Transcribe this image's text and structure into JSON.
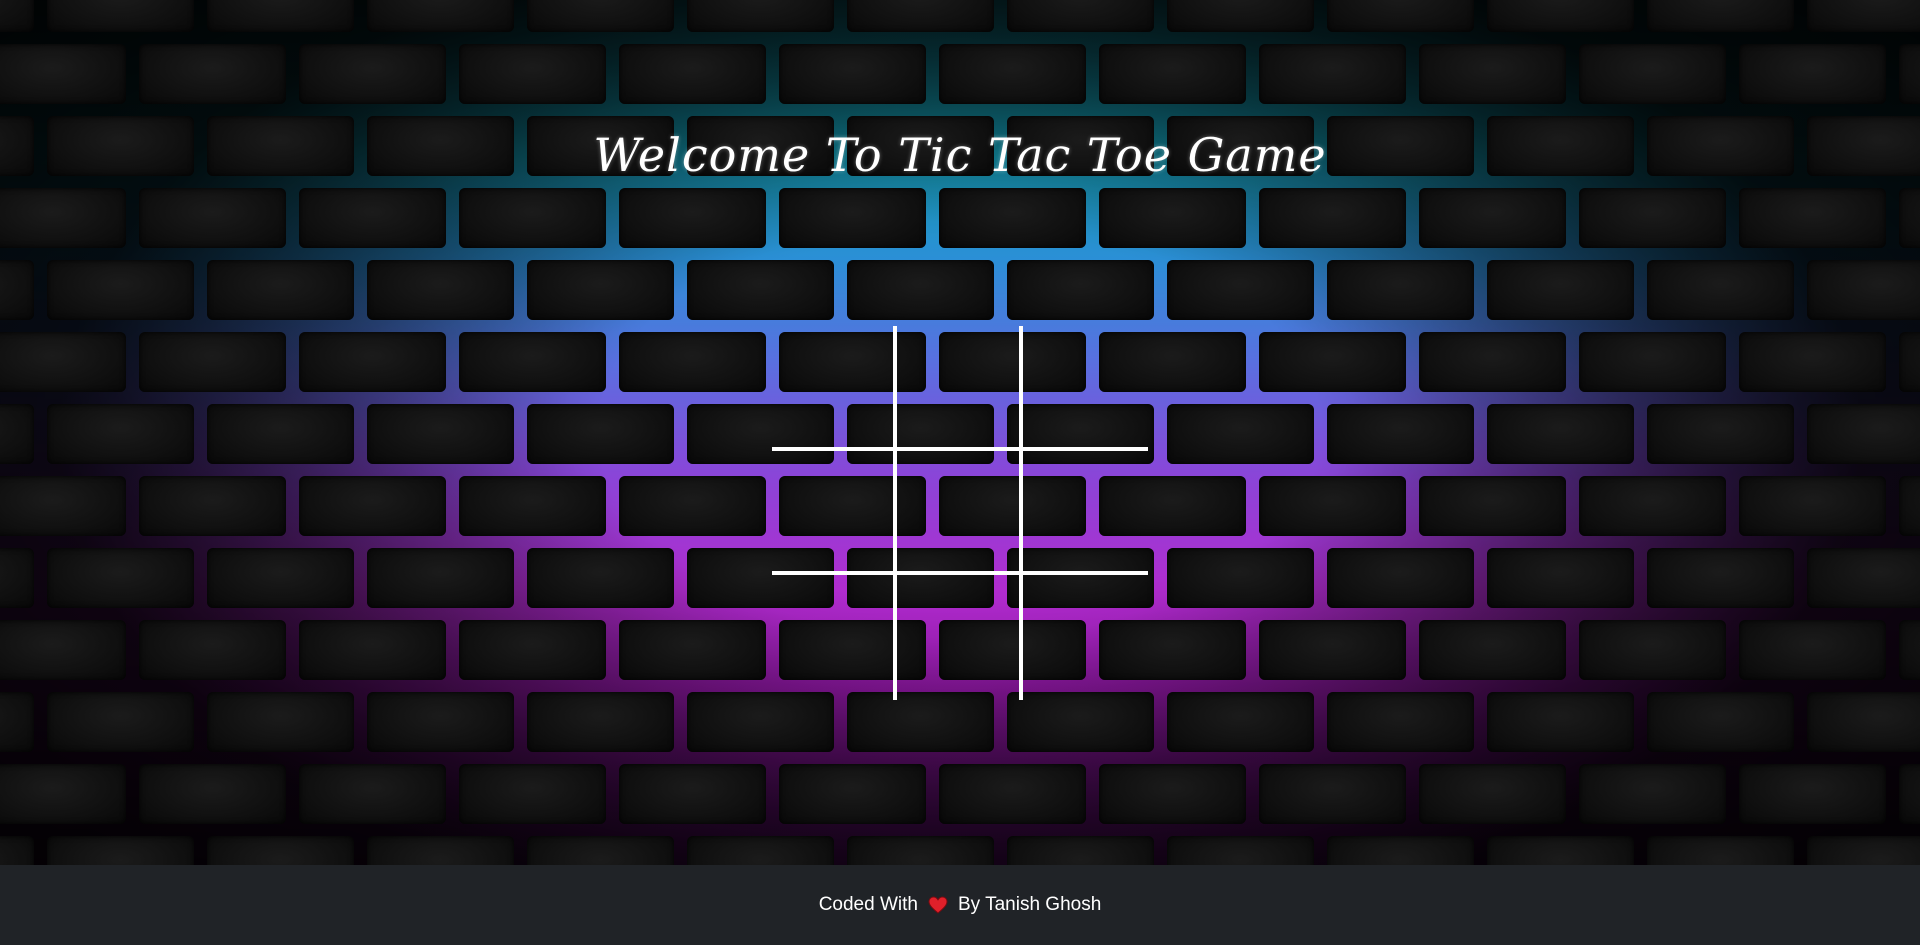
{
  "header": {
    "title": "Welcome To Tic Tac Toe Game"
  },
  "board": {
    "rows": 3,
    "cols": 3,
    "cells": [
      "",
      "",
      "",
      "",
      "",
      "",
      "",
      "",
      ""
    ]
  },
  "footer": {
    "text_before": "Coded With",
    "icon": "heart-icon",
    "text_after": "By Tanish Ghosh"
  },
  "colors": {
    "grid_lines": "#ffffff",
    "footer_bg": "#202327",
    "heart": "#e0202a"
  }
}
